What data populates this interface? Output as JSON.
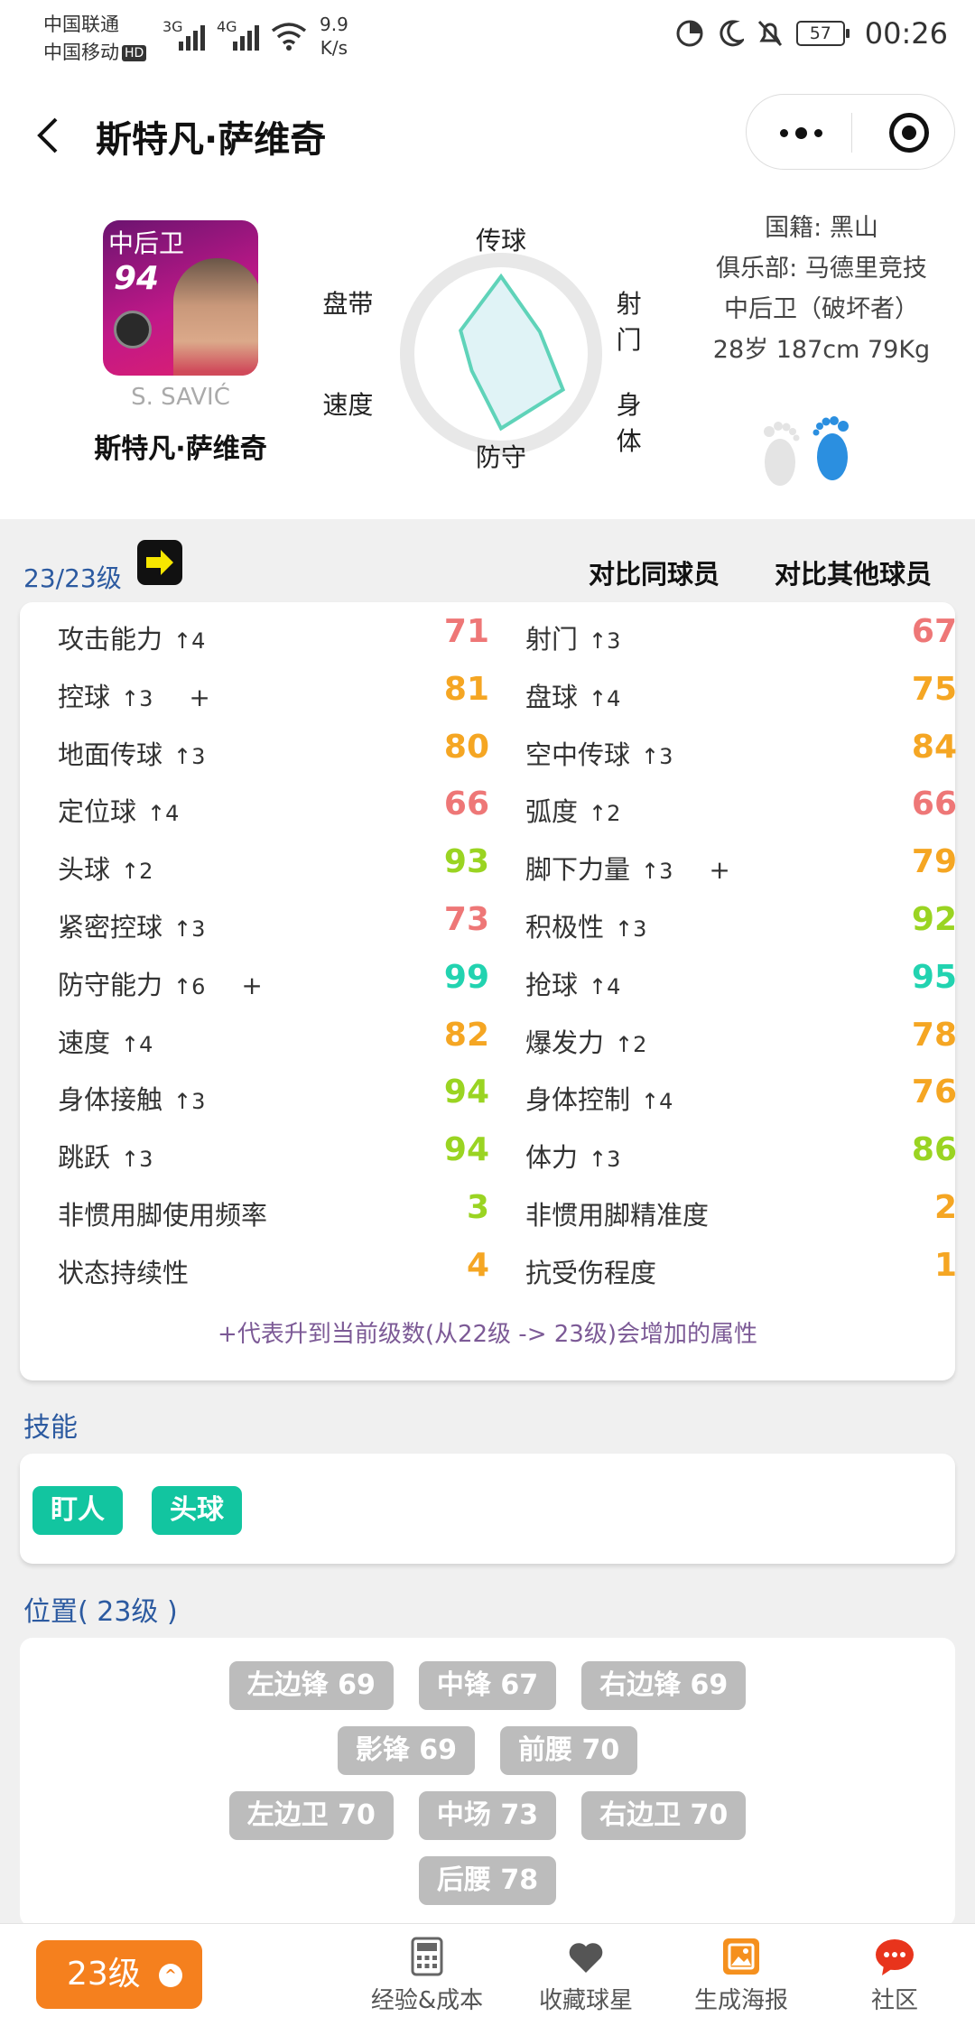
{
  "status": {
    "carrier1": "中国联通",
    "carrier2": "中国移动",
    "hd": "HD",
    "sig1": "3G",
    "sig2": "4G",
    "speed_val": "9.9",
    "speed_unit": "K/s",
    "battery": "57",
    "time": "00:26"
  },
  "header": {
    "title": "斯特凡·萨维奇"
  },
  "player": {
    "card_position": "中后卫",
    "card_rating": "94",
    "en_name": "S. SAVIĆ",
    "cn_name": "斯特凡·萨维奇",
    "nationality": "国籍: 黑山",
    "club": "俱乐部: 马德里竞技",
    "role": "中后卫（破坏者）",
    "body": "28岁 187cm 79Kg"
  },
  "radar": {
    "labels": [
      "传球",
      "射门",
      "身体",
      "防守",
      "速度",
      "盘带"
    ],
    "values": [
      0.78,
      0.45,
      0.72,
      0.75,
      0.34,
      0.47
    ],
    "fill": "#e0f3f6",
    "stroke": "#5fd3b9"
  },
  "level": {
    "text": "23/23级",
    "compare_same": "对比同球员",
    "compare_other": "对比其他球员"
  },
  "colors": {
    "red": "#ee7777",
    "orange": "#f5a623",
    "green": "#9ad422",
    "cyan": "#22d3b0"
  },
  "stats_left": [
    {
      "name": "攻击能力",
      "up": "↑4",
      "plus": "",
      "value": "71",
      "color": "#ee7777"
    },
    {
      "name": "控球",
      "up": "↑3",
      "plus": "+",
      "value": "81",
      "color": "#f5a623"
    },
    {
      "name": "地面传球",
      "up": "↑3",
      "plus": "",
      "value": "80",
      "color": "#f5a623"
    },
    {
      "name": "定位球",
      "up": "↑4",
      "plus": "",
      "value": "66",
      "color": "#ee7777"
    },
    {
      "name": "头球",
      "up": "↑2",
      "plus": "",
      "value": "93",
      "color": "#9ad422"
    },
    {
      "name": "紧密控球",
      "up": "↑3",
      "plus": "",
      "value": "73",
      "color": "#ee7777"
    },
    {
      "name": "防守能力",
      "up": "↑6",
      "plus": "+",
      "value": "99",
      "color": "#22d3b0"
    },
    {
      "name": "速度",
      "up": "↑4",
      "plus": "",
      "value": "82",
      "color": "#f5a623"
    },
    {
      "name": "身体接触",
      "up": "↑3",
      "plus": "",
      "value": "94",
      "color": "#9ad422"
    },
    {
      "name": "跳跃",
      "up": "↑3",
      "plus": "",
      "value": "94",
      "color": "#9ad422"
    },
    {
      "name": "非惯用脚使用频率",
      "up": "",
      "plus": "",
      "value": "3",
      "color": "#9ad422"
    },
    {
      "name": "状态持续性",
      "up": "",
      "plus": "",
      "value": "4",
      "color": "#f5a623"
    }
  ],
  "stats_right": [
    {
      "name": "射门",
      "up": "↑3",
      "plus": "",
      "value": "67",
      "color": "#ee7777"
    },
    {
      "name": "盘球",
      "up": "↑4",
      "plus": "",
      "value": "75",
      "color": "#f5a623"
    },
    {
      "name": "空中传球",
      "up": "↑3",
      "plus": "",
      "value": "84",
      "color": "#f5a623"
    },
    {
      "name": "弧度",
      "up": "↑2",
      "plus": "",
      "value": "66",
      "color": "#ee7777"
    },
    {
      "name": "脚下力量",
      "up": "↑3",
      "plus": "+",
      "value": "79",
      "color": "#f5a623"
    },
    {
      "name": "积极性",
      "up": "↑3",
      "plus": "",
      "value": "92",
      "color": "#9ad422"
    },
    {
      "name": "抢球",
      "up": "↑4",
      "plus": "",
      "value": "95",
      "color": "#22d3b0"
    },
    {
      "name": "爆发力",
      "up": "↑2",
      "plus": "",
      "value": "78",
      "color": "#f5a623"
    },
    {
      "name": "身体控制",
      "up": "↑4",
      "plus": "",
      "value": "76",
      "color": "#f5a623"
    },
    {
      "name": "体力",
      "up": "↑3",
      "plus": "",
      "value": "86",
      "color": "#9ad422"
    },
    {
      "name": "非惯用脚精准度",
      "up": "",
      "plus": "",
      "value": "2",
      "color": "#f5a623"
    },
    {
      "name": "抗受伤程度",
      "up": "",
      "plus": "",
      "value": "1",
      "color": "#f5a623"
    }
  ],
  "note": "+代表升到当前级数(从22级 -> 23级)会增加的属性",
  "skills": {
    "title": "技能",
    "items": [
      "盯人",
      "头球"
    ]
  },
  "positions": {
    "title": "位置( 23级 )",
    "rows": [
      [
        "左边锋 69",
        "中锋 67",
        "右边锋 69"
      ],
      [
        "影锋 69",
        "前腰 70"
      ],
      [
        "左边卫 70",
        "中场 73",
        "右边卫 70"
      ],
      [
        "后腰 78"
      ]
    ]
  },
  "bottom": {
    "level_button": "23级",
    "nav": [
      "经验&成本",
      "收藏球星",
      "生成海报",
      "社区"
    ]
  }
}
